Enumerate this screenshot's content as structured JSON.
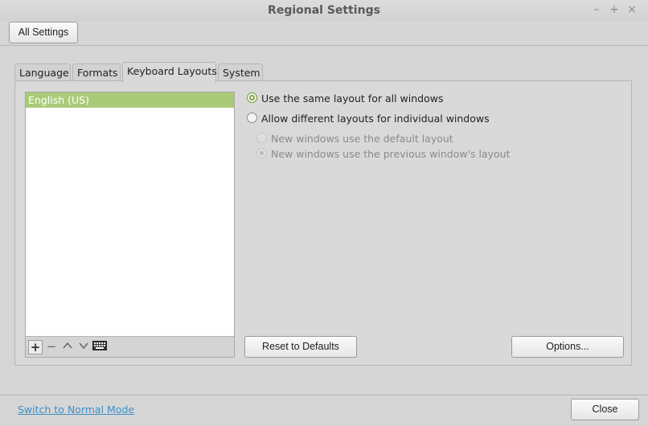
{
  "window": {
    "title": "Regional Settings",
    "controls": {
      "minimize": "–",
      "maximize": "+",
      "close": "×"
    }
  },
  "toolbar": {
    "all_settings_label": "All Settings"
  },
  "tabs": [
    {
      "label": "Language",
      "active": false
    },
    {
      "label": "Formats",
      "active": false
    },
    {
      "label": "Keyboard Layouts",
      "active": true
    },
    {
      "label": "System",
      "active": false
    }
  ],
  "layouts_list": {
    "items": [
      "English (US)"
    ],
    "selected_index": 0,
    "tools": [
      "add-icon",
      "remove-icon",
      "move-up-icon",
      "move-down-icon",
      "keyboard-icon"
    ]
  },
  "options": {
    "same_layout_label": "Use the same layout for all windows",
    "different_layouts_label": "Allow different layouts for individual windows",
    "default_layout_label": "New windows use the default layout",
    "previous_layout_label": "New windows use the previous window's layout",
    "selected": "same_layout"
  },
  "buttons": {
    "reset_label": "Reset to Defaults",
    "options_label": "Options...",
    "close_label": "Close"
  },
  "footer": {
    "mode_link": "Switch to Normal Mode"
  },
  "colors": {
    "accent": "#a9cb79",
    "radio_accent": "#7ba63e",
    "link": "#3d8fc5"
  }
}
